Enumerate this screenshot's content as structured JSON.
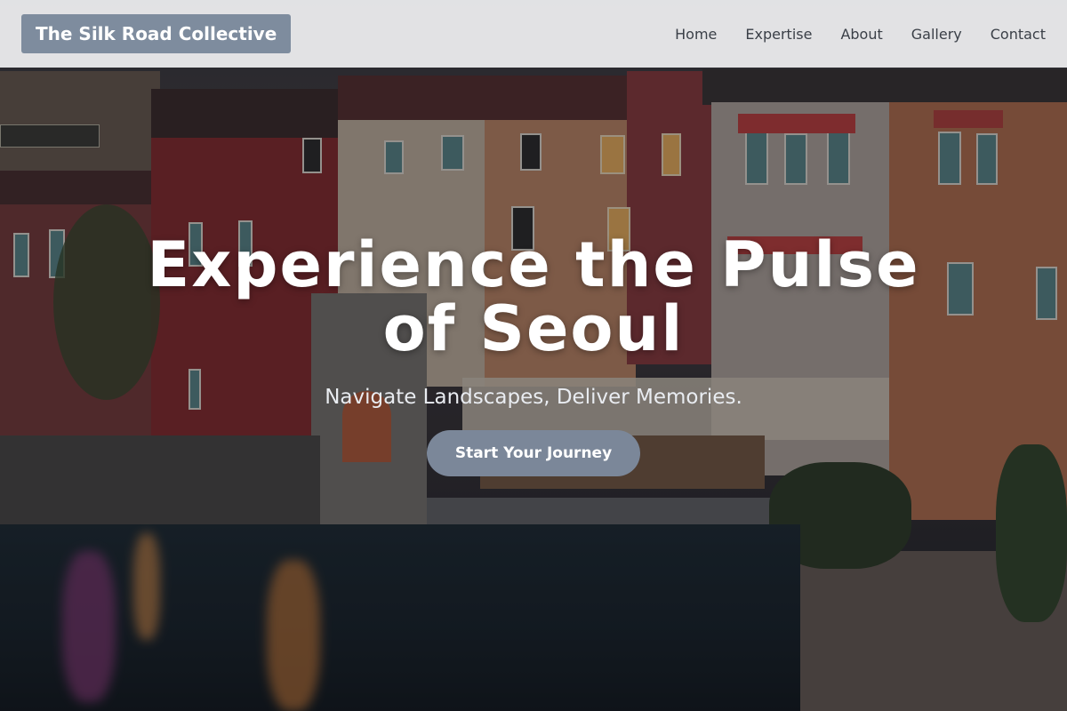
{
  "brand": {
    "name": "The Silk Road Collective"
  },
  "nav": {
    "items": [
      {
        "label": "Home"
      },
      {
        "label": "Expertise"
      },
      {
        "label": "About"
      },
      {
        "label": "Gallery"
      },
      {
        "label": "Contact"
      }
    ]
  },
  "hero": {
    "title": "Experience the Pulse of Seoul",
    "subtitle": "Navigate Landscapes, Deliver Memories.",
    "cta_label": "Start Your Journey",
    "background_image": "evening-waterfront-town-photo"
  },
  "colors": {
    "navbar_bg": "#f0f0f2",
    "brand_bg": "#7e8c9e",
    "cta_bg": "#7b8799",
    "nav_text": "#3a3f47",
    "hero_text": "#ffffff"
  }
}
